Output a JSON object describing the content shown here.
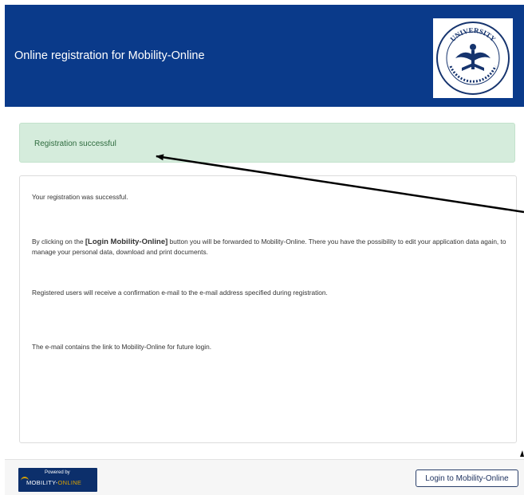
{
  "header": {
    "title": "Online registration for Mobility-Online",
    "logo_text": "UNIVERSITY"
  },
  "alert": {
    "text": "Registration successful"
  },
  "content": {
    "p1": "Your registration was successful.",
    "p2_prefix": "By clicking on the ",
    "p2_strong": "[Login Mobility-Online]",
    "p2_suffix": " button you will be forwarded to Mobility-Online. There you have the possibility to edit your application data again, to manage your personal data, download and print documents.",
    "p3": "Registered users will receive a confirmation e-mail to the e-mail address specified during registration.",
    "p4": "The e-mail contains the link to Mobility-Online for future login."
  },
  "footer": {
    "powered_by": "Powered by",
    "brand_a": "MOBILITY-",
    "brand_b": "ONLINE",
    "login_button": "Login to Mobility-Online"
  },
  "colors": {
    "header_bg": "#0a3a8a",
    "alert_bg": "#d5ecdc",
    "alert_text": "#2e6b3e",
    "button_border": "#2a3f6a"
  }
}
